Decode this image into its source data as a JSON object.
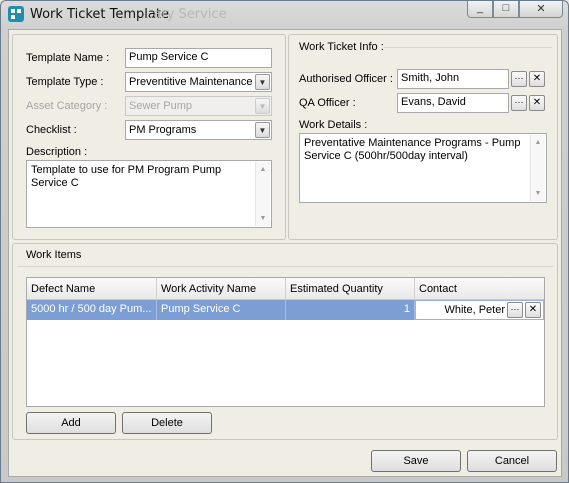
{
  "window": {
    "title": "Work Ticket Template",
    "title_ghost": "...ary Service",
    "buttons": {
      "minimize": "_",
      "maximize": "□",
      "close": "✕"
    }
  },
  "template": {
    "name_label": "Template Name :",
    "name_value": "Pump Service C",
    "type_label": "Template Type :",
    "type_value": "Preventitive Maintenance",
    "asset_label": "Asset Category :",
    "asset_value": "Sewer Pump",
    "checklist_label": "Checklist :",
    "checklist_value": "PM Programs",
    "description_label": "Description :",
    "description_value": "Template to use for PM Program Pump Service C"
  },
  "ticket_info": {
    "title": "Work Ticket Info :",
    "authorised_label": "Authorised Officer :",
    "authorised_value": "Smith, John",
    "qa_label": "QA Officer :",
    "qa_value": "Evans, David",
    "details_label": "Work Details :",
    "details_value": "Preventative Maintenance Programs - Pump Service C (500hr/500day interval)"
  },
  "work_items": {
    "title": "Work Items",
    "columns": [
      "Defect Name",
      "Work Activity Name",
      "Estimated Quantity",
      "Contact"
    ],
    "rows": [
      {
        "defect": "5000 hr / 500 day Pum...",
        "activity": "Pump Service C",
        "quantity": "1",
        "contact": "White, Peter"
      }
    ],
    "add_label": "Add",
    "delete_label": "Delete"
  },
  "footer": {
    "save_label": "Save",
    "cancel_label": "Cancel"
  },
  "icons": {
    "lookup": "ellipsis-icon",
    "clear": "close-x-icon",
    "dropdown": "chevron-down-icon"
  }
}
